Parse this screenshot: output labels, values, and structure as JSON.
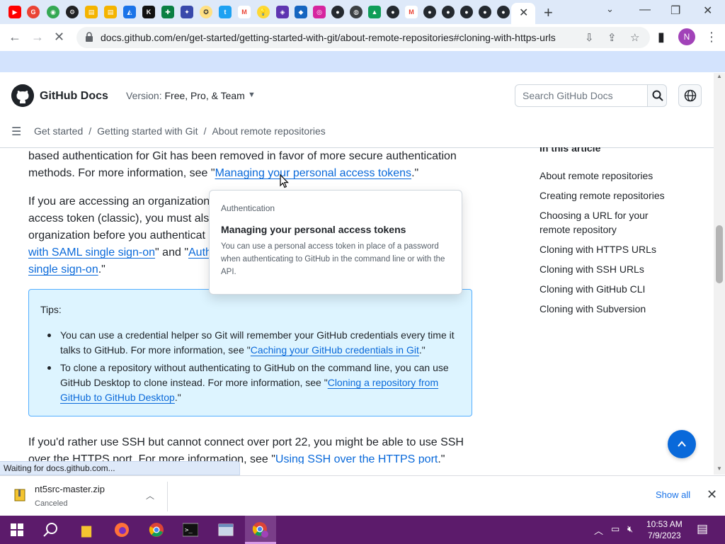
{
  "browser": {
    "active_tab_close": "✕",
    "new_tab": "+",
    "url": "docs.github.com/en/get-started/getting-started-with-git/about-remote-repositories#cloning-with-https-urls",
    "profile_initial": "N"
  },
  "header": {
    "site_title": "GitHub Docs",
    "version_label": "Version:",
    "version_value": "Free, Pro, & Team",
    "search_placeholder": "Search GitHub Docs"
  },
  "breadcrumb": {
    "items": [
      "Get started",
      "Getting started with Git",
      "About remote repositories"
    ]
  },
  "content": {
    "p1_before": "based authentication for Git has been removed in favor of more secure authentication methods. For more information, see \"",
    "p1_link": "Managing your personal access tokens",
    "p1_after": ".\"",
    "p2_line1": "If you are accessing an organization",
    "p2_line2": "access token (classic), you must also",
    "p2_line3": "organization before you authenticat",
    "p2_link1": "with SAML single sign-on",
    "p2_mid": "\" and \"",
    "p2_link2_start": "Auth",
    "p2_link3": "single sign-on",
    "p2_end": ".\"",
    "tips_title": "Tips:",
    "tip1_text": "You can use a credential helper so Git will remember your GitHub credentials every time it talks to GitHub. For more information, see \"",
    "tip1_link": "Caching your GitHub credentials in Git",
    "tip1_end": ".\"",
    "tip2_text": "To clone a repository without authenticating to GitHub on the command line, you can use GitHub Desktop to clone instead. For more information, see \"",
    "tip2_link": "Cloning a repository from GitHub to GitHub Desktop",
    "tip2_end": ".\"",
    "p3_line1": "If you'd rather use SSH but cannot connect over port 22, you might be able to use SSH",
    "p3_line2_before": "over the HTTPS port. For more information, see \"",
    "p3_link": "Using SSH over the HTTPS port",
    "p3_end": ".\""
  },
  "hovercard": {
    "product": "Authentication",
    "title": "Managing your personal access tokens",
    "description": "You can use a personal access token in place of a password when authenticating to GitHub in the command line or with the API."
  },
  "toc": {
    "heading": "In this article",
    "items": [
      "About remote repositories",
      "Creating remote repositories",
      "Choosing a URL for your remote repository",
      "Cloning with HTTPS URLs",
      "Cloning with SSH URLs",
      "Cloning with GitHub CLI",
      "Cloning with Subversion"
    ]
  },
  "status_text": "Waiting for docs.github.com...",
  "download": {
    "filename": "nt5src-master.zip",
    "status": "Canceled",
    "show_all": "Show all"
  },
  "taskbar": {
    "time": "10:53 AM",
    "date": "7/9/2023"
  },
  "colors": {
    "link": "#0969da",
    "tip_bg": "#ddf4ff",
    "tip_border": "#54aeff",
    "taskbar": "#5c1b6b"
  }
}
